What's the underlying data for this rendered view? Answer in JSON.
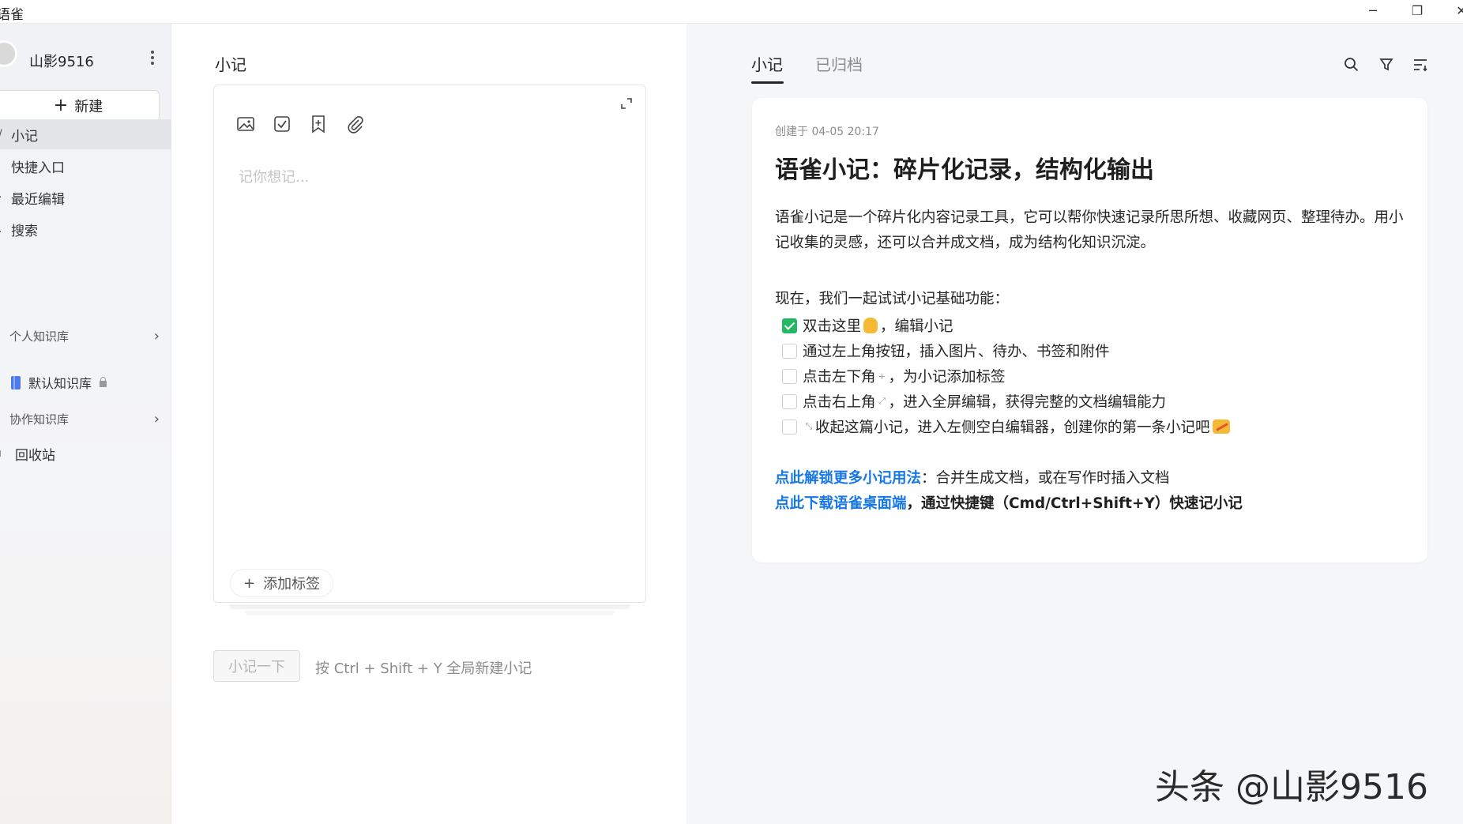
{
  "window": {
    "title": "语雀",
    "minimize_glyph": "─",
    "maximize_glyph": "❐",
    "close_glyph": "✕"
  },
  "sidebar": {
    "username": "山影9516",
    "new_button": "新建",
    "new_button_plus": "+",
    "items": [
      {
        "label": "小记",
        "active": true,
        "icon": "note-icon"
      },
      {
        "label": "快捷入口",
        "icon": "shortcut-icon"
      },
      {
        "label": "最近编辑",
        "icon": "recent-icon"
      },
      {
        "label": "搜索",
        "icon": "search-icon"
      }
    ],
    "groups": {
      "personal": "个人知识库",
      "default_kb": "默认知识库",
      "collab": "协作知识库"
    },
    "trash": "回收站",
    "chevron_glyph": "›"
  },
  "editor": {
    "title": "小记",
    "placeholder": "记你想记...",
    "tag_button": "添加标签",
    "tag_plus": "+",
    "submit_button": "小记一下",
    "hint": "按 Ctrl + Shift + Y 全局新建小记"
  },
  "notes": {
    "tabs": [
      "小记",
      "已归档"
    ],
    "card": {
      "created": "创建于 04-05 20:17",
      "title": "语雀小记：碎片化记录，结构化输出",
      "paragraph": "语雀小记是一个碎片化内容记录工具，它可以帮你快速记录所思所想、收藏网页、整理待办。用小记收集的灵感，还可以合并成文档，成为结构化知识沉淀。",
      "intro": "现在，我们一起试试小记基础功能：",
      "todos": [
        {
          "before": "双击这里",
          "after": "，编辑小记",
          "checked": true
        },
        {
          "before": "通过左上角按钮，插入图片、待办、书签和附件",
          "after": "",
          "checked": false
        },
        {
          "before": "点击左下角",
          "after": "，为小记添加标签",
          "checked": false
        },
        {
          "before": "点击右上角",
          "after": "，进入全屏编辑，获得完整的文档编辑能力",
          "checked": false
        },
        {
          "before": "收起这篇小记，进入左侧空白编辑器，创建你的第一条小记吧",
          "after": "",
          "checked": false
        }
      ],
      "link1": "点此解锁更多小记用法",
      "link1_rest": "：合并生成文档，或在写作时插入文档",
      "link2": "点此下载语雀桌面端",
      "link2_rest": "，通过快捷键（Cmd/Ctrl+Shift+Y）快速记小记"
    }
  },
  "watermark": "头条 @山影9516",
  "colors": {
    "accent_link": "#1677e6",
    "check_green": "#25b864",
    "book_blue": "#4b7bec"
  }
}
